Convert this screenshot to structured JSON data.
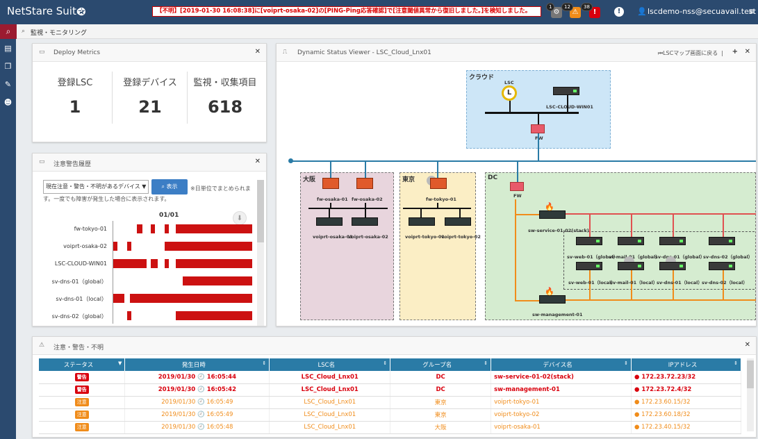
{
  "app": {
    "brand": "NetStare Suite",
    "user": "lscdemo-nss@secuavail.test"
  },
  "alert_message": "【不明】[2019-01-30 16:08:38]に[voiprt-osaka-02]の[PING-Ping応答確認]で[注意閾値異常から復旧しました。]を検知しました。",
  "notifications": [
    {
      "count": "1",
      "icon": "bell-gray"
    },
    {
      "count": "12",
      "icon": "warning"
    },
    {
      "count": "38",
      "icon": "error"
    }
  ],
  "breadcrumb": "監視・モニタリング",
  "metrics": {
    "title": "Deploy Metrics",
    "items": [
      {
        "label": "登録LSC",
        "value": "1"
      },
      {
        "label": "登録デバイス",
        "value": "21"
      },
      {
        "label": "監視・収集項目",
        "value": "618"
      }
    ]
  },
  "history": {
    "title": "注意警告履歴",
    "select": "現在注意・警告・不明があるデバイス ▼",
    "button": "表示",
    "note": "※日単位でまとめられます。一度でも障害が発生した場合に表示されます。",
    "date": "01/01",
    "rows": [
      {
        "label": "fw-tokyo-01",
        "segments": [
          [
            0.17,
            0.04
          ],
          [
            0.27,
            0.03
          ],
          [
            0.37,
            0.03
          ],
          [
            0.45,
            0.55
          ]
        ]
      },
      {
        "label": "voiprt-osaka-02",
        "segments": [
          [
            0.0,
            0.03
          ],
          [
            0.1,
            0.03
          ],
          [
            0.37,
            0.63
          ]
        ]
      },
      {
        "label": "LSC-CLOUD-WIN01",
        "segments": [
          [
            0.0,
            0.24
          ],
          [
            0.27,
            0.05
          ],
          [
            0.37,
            0.03
          ],
          [
            0.45,
            0.55
          ]
        ]
      },
      {
        "label": "sv-dns-01（global）",
        "segments": [
          [
            0.5,
            0.5
          ]
        ]
      },
      {
        "label": "sv-dns-01（local）",
        "segments": [
          [
            0.0,
            0.08
          ],
          [
            0.12,
            0.88
          ]
        ]
      },
      {
        "label": "sv-dns-02（global）",
        "segments": [
          [
            0.1,
            0.03
          ],
          [
            0.45,
            0.55
          ]
        ]
      }
    ]
  },
  "dsv": {
    "title": "Dynamic Status Viewer - LSC_Cloud_Lnx01",
    "back": "LSCマップ画面に戻る",
    "zones": {
      "cloud": "クラウド",
      "osaka": "大阪",
      "tokyo": "東京",
      "dc": "DC"
    },
    "labels": {
      "lsc": "LSC",
      "cloud_win": "LSC-CLOUD-WIN01",
      "fw": "FW",
      "fw_dc": "FW",
      "fw_osaka_01": "fw-osaka-01",
      "fw_osaka_02": "fw-osaka-02",
      "fw_tokyo": "fw-tokyo-01",
      "vo1": "voiprt-osaka-01",
      "vo2": "voiprt-osaka-02",
      "vt1": "voiprt-tokyo-01",
      "vt2": "voiprt-tokyo-02",
      "sw_service": "sw-service-01-02(stack)",
      "sw_mgmt": "sw-management-01",
      "web_g": "sv-web-01（global）",
      "mail_g": "sv-mail-01（global）",
      "dns1_g": "sv-dns-01（global）",
      "dns2_g": "sv-dns-02（global）",
      "web_l": "sv-web-01（local）",
      "mail_l": "sv-mail-01（local）",
      "dns1_l": "sv-dns-01（local）",
      "dns2_l": "sv-dns-02（local）"
    }
  },
  "alerts": {
    "title": "注意・警告・不明",
    "columns": [
      "ステータス",
      "発生日時",
      "LSC名",
      "グループ名",
      "デバイス名",
      "IPアドレス"
    ],
    "rows": [
      {
        "status": "警告",
        "level": "warn",
        "time": "2019/01/30 🕘 16:05:44",
        "lsc": "LSC_Cloud_Lnx01",
        "group": "DC",
        "device": "sw-service-01-02(stack)",
        "ip": "172.23.72.23/32"
      },
      {
        "status": "警告",
        "level": "warn",
        "time": "2019/01/30 🕘 16:05:42",
        "lsc": "LSC_Cloud_Lnx01",
        "group": "DC",
        "device": "sw-management-01",
        "ip": "172.23.72.4/32"
      },
      {
        "status": "注意",
        "level": "caution",
        "time": "2019/01/30 🕘 16:05:49",
        "lsc": "LSC_Cloud_Lnx01",
        "group": "東京",
        "device": "voiprt-tokyo-01",
        "ip": "172.23.60.15/32"
      },
      {
        "status": "注意",
        "level": "caution",
        "time": "2019/01/30 🕘 16:05:49",
        "lsc": "LSC_Cloud_Lnx01",
        "group": "東京",
        "device": "voiprt-tokyo-02",
        "ip": "172.23.60.18/32"
      },
      {
        "status": "注意",
        "level": "caution",
        "time": "2019/01/30 🕘 16:05:48",
        "lsc": "LSC_Cloud_Lnx01",
        "group": "大阪",
        "device": "voiprt-osaka-01",
        "ip": "172.23.40.15/32"
      }
    ]
  },
  "colors": {
    "warn": "#d9000d",
    "caution": "#f08c1a",
    "cloud": "#cde6f7",
    "osaka": "#e8d5dd",
    "tokyo": "#fbeec5",
    "dc": "#d5ecd0",
    "link": "#2a7ba6",
    "red_link": "#e05050",
    "orange_link": "#f08c1a"
  }
}
